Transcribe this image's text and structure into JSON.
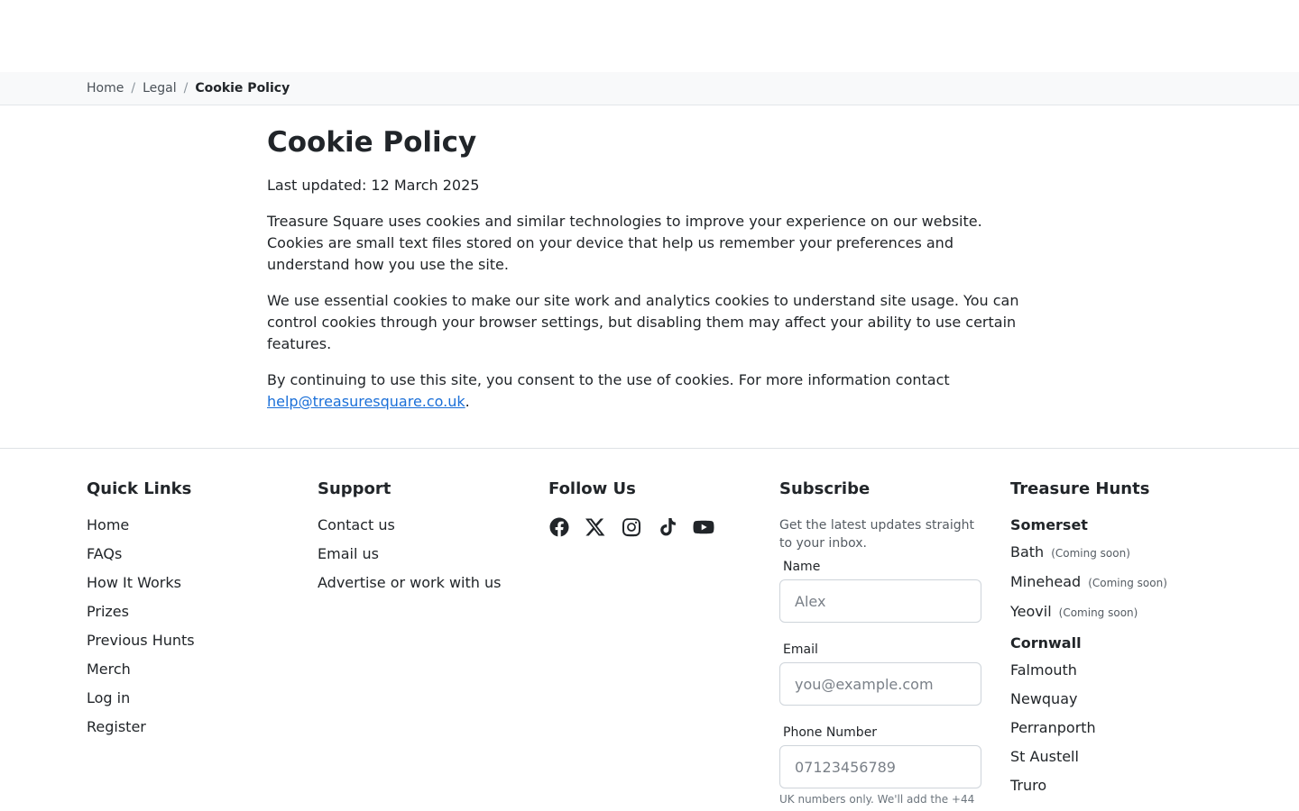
{
  "breadcrumb": {
    "items": [
      "Home",
      "Legal"
    ],
    "current": "Cookie Policy"
  },
  "page": {
    "title": "Cookie Policy",
    "updated": "Last updated: 12 March 2025",
    "paragraph1": "Treasure Square uses cookies and similar technologies to improve your experience on our website. Cookies are small text files stored on your device that help us remember your preferences and understand how you use the site.",
    "paragraph2": "We use essential cookies to make our site work and analytics cookies to understand site usage. You can control cookies through your browser settings, but disabling them may affect your ability to use certain features.",
    "paragraph3_prefix": "By continuing to use this site, you consent to the use of cookies. For more information contact ",
    "contact_email": "help@treasuresquare.co.uk",
    "paragraph3_suffix": "."
  },
  "footer": {
    "quick_links": {
      "heading": "Quick Links",
      "items": [
        "Home",
        "FAQs",
        "How It Works",
        "Prizes",
        "Previous Hunts",
        "Merch",
        "Log in",
        "Register"
      ]
    },
    "support": {
      "heading": "Support",
      "items": [
        "Contact us",
        "Email us",
        "Advertise or work with us"
      ]
    },
    "follow": {
      "heading": "Follow Us",
      "icons": [
        "facebook-icon",
        "x-icon",
        "instagram-icon",
        "tiktok-icon",
        "youtube-icon"
      ]
    },
    "subscribe": {
      "heading": "Subscribe",
      "description": "Get the latest updates straight to your inbox.",
      "name_label": "Name",
      "name_placeholder": "Alex",
      "email_label": "Email",
      "email_placeholder": "you@example.com",
      "phone_label": "Phone Number",
      "phone_placeholder": "07123456789",
      "phone_hint": "UK numbers only. We'll add the +44"
    },
    "hunts": {
      "heading": "Treasure Hunts",
      "regions": [
        {
          "name": "Somerset",
          "towns": [
            {
              "name": "Bath",
              "note": "(Coming soon)"
            },
            {
              "name": "Minehead",
              "note": "(Coming soon)"
            },
            {
              "name": "Yeovil",
              "note": "(Coming soon)"
            }
          ]
        },
        {
          "name": "Cornwall",
          "towns": [
            {
              "name": "Falmouth",
              "note": ""
            },
            {
              "name": "Newquay",
              "note": ""
            },
            {
              "name": "Perranporth",
              "note": ""
            },
            {
              "name": "St Austell",
              "note": ""
            },
            {
              "name": "Truro",
              "note": ""
            }
          ]
        }
      ]
    }
  }
}
